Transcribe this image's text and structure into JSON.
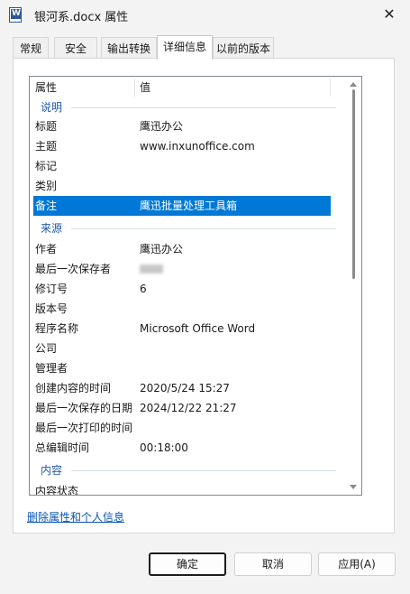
{
  "window": {
    "title": "银河系.docx 属性",
    "close_glyph": "✕"
  },
  "tabs": [
    {
      "label": "常规"
    },
    {
      "label": "安全"
    },
    {
      "label": "输出转换"
    },
    {
      "label": "详细信息",
      "active": true
    },
    {
      "label": "以前的版本"
    }
  ],
  "list": {
    "headers": {
      "property": "属性",
      "value": "值"
    },
    "groups": {
      "description": "说明",
      "origin": "来源",
      "content": "内容"
    },
    "description_rows": [
      {
        "key": "标题",
        "value": "鹰迅办公"
      },
      {
        "key": "主题",
        "value": "www.inxunoffice.com"
      },
      {
        "key": "标记",
        "value": ""
      },
      {
        "key": "类别",
        "value": ""
      },
      {
        "key": "备注",
        "value": "鹰迅批量处理工具箱",
        "selected": true
      }
    ],
    "origin_rows": [
      {
        "key": "作者",
        "value": "鹰迅办公"
      },
      {
        "key": "最后一次保存者",
        "value": ""
      },
      {
        "key": "修订号",
        "value": "6"
      },
      {
        "key": "版本号",
        "value": ""
      },
      {
        "key": "程序名称",
        "value": "Microsoft Office Word"
      },
      {
        "key": "公司",
        "value": ""
      },
      {
        "key": "管理者",
        "value": ""
      },
      {
        "key": "创建内容的时间",
        "value": "2020/5/24 15:27"
      },
      {
        "key": "最后一次保存的日期",
        "value": "2024/12/22 21:27"
      },
      {
        "key": "最后一次打印的时间",
        "value": ""
      },
      {
        "key": "总编辑时间",
        "value": "00:18:00"
      }
    ],
    "content_rows": [
      {
        "key": "内容状态",
        "value": ""
      }
    ]
  },
  "remove_link": "删除属性和个人信息",
  "buttons": {
    "ok": "确定",
    "cancel": "取消",
    "apply": "应用(A)"
  },
  "colors": {
    "selection": "#0078d7",
    "group_text": "#1e5aa8",
    "link": "#0a55b3"
  }
}
